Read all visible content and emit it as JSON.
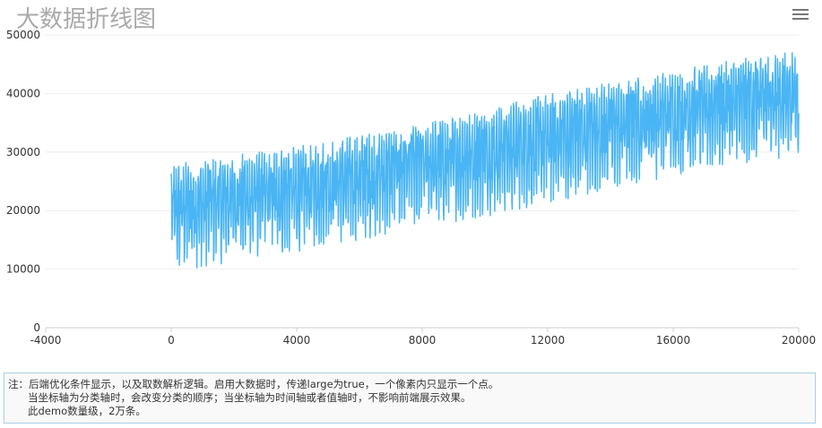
{
  "title": "大数据折线图",
  "colors": {
    "series": "#4ab5f4",
    "title": "#aaaaaa",
    "grid": "#eeeeee",
    "axis": "#cccccc"
  },
  "toolbar": {
    "menu_icon": "hamburger-menu-icon"
  },
  "note": {
    "line1": "注：后端优化条件显示，以及取数解析逻辑。启用大数据时，传递large为true，一个像素内只显示一个点。",
    "line2": "当坐标轴为分类轴时，会改变分类的顺序；当坐标轴为时间轴或者值轴时，不影响前端展示效果。",
    "line3": "此demo数量级，2万条。"
  },
  "chart_data": {
    "type": "line",
    "title": "大数据折线图",
    "xlabel": "",
    "ylabel": "",
    "xlim": [
      -4000,
      20000
    ],
    "ylim": [
      0,
      50000
    ],
    "x_ticks": [
      -4000,
      0,
      4000,
      8000,
      12000,
      16000,
      20000
    ],
    "y_ticks": [
      0,
      10000,
      20000,
      30000,
      40000,
      50000
    ],
    "grid": "horizontal",
    "point_count": 20000,
    "x_range": [
      0,
      20000
    ],
    "envelope": {
      "upper": [
        [
          0,
          28000
        ],
        [
          4000,
          31000
        ],
        [
          8000,
          35000
        ],
        [
          12000,
          40000
        ],
        [
          16000,
          44000
        ],
        [
          20000,
          47500
        ]
      ],
      "lower": [
        [
          0,
          8500
        ],
        [
          4000,
          12000
        ],
        [
          8000,
          16000
        ],
        [
          12000,
          20000
        ],
        [
          16000,
          25000
        ],
        [
          20000,
          28500
        ]
      ]
    },
    "series": [
      {
        "values": []
      }
    ]
  }
}
